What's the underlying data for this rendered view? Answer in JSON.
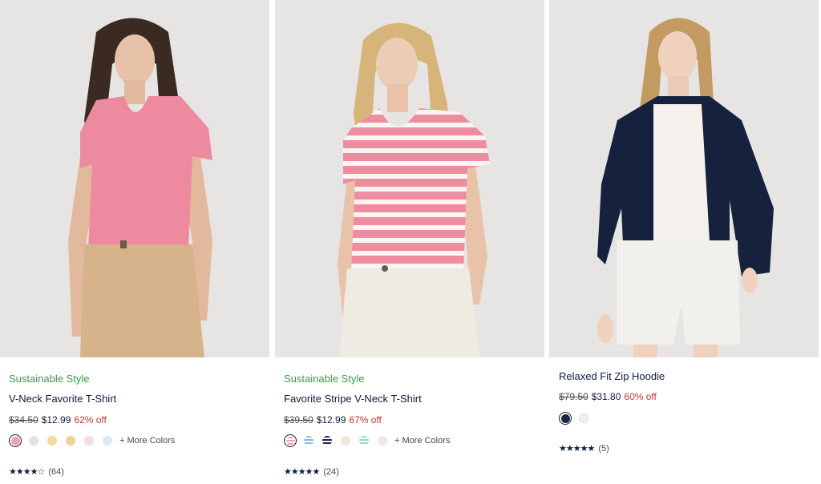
{
  "products": [
    {
      "tag": "Sustainable Style",
      "title": "V-Neck Favorite T-Shirt",
      "was_price": "$34.50",
      "price": "$12.99",
      "discount": "62% off",
      "swatches": [
        "#f2a3b3",
        "#e4e2de",
        "#f1dca0",
        "#f4cf9c",
        "#f7dde0",
        "#dbe8f5"
      ],
      "more_colors": "+ More Colors",
      "rating_count": "(64)",
      "stars": "★★★★☆",
      "rating_value": 4.5
    },
    {
      "tag": "Sustainable Style",
      "title": "Favorite Stripe V-Neck T-Shirt",
      "was_price": "$39.50",
      "price": "$12.99",
      "discount": "67% off",
      "swatches": [
        "#f0a1ae",
        "#8bb8e0",
        "#1b2541",
        "#efe8d6",
        "#8fd8d2",
        "#efe8e6"
      ],
      "more_colors": "+ More Colors",
      "rating_count": "(24)",
      "stars": "★★★★★",
      "rating_value": 5
    },
    {
      "tag": "",
      "title": "Relaxed Fit Zip Hoodie",
      "was_price": "$79.50",
      "price": "$31.80",
      "discount": "60% off",
      "swatches": [
        "#1a2540",
        "#f1f0ed"
      ],
      "more_colors": "",
      "rating_count": "(5)",
      "stars": "★★★★★",
      "rating_value": 5
    }
  ],
  "colors": {
    "navy": "#0c1d3e",
    "sale_red": "#c0392b",
    "sustainable_green": "#3c9a4a",
    "photo_bg": "#e8e8e7"
  }
}
